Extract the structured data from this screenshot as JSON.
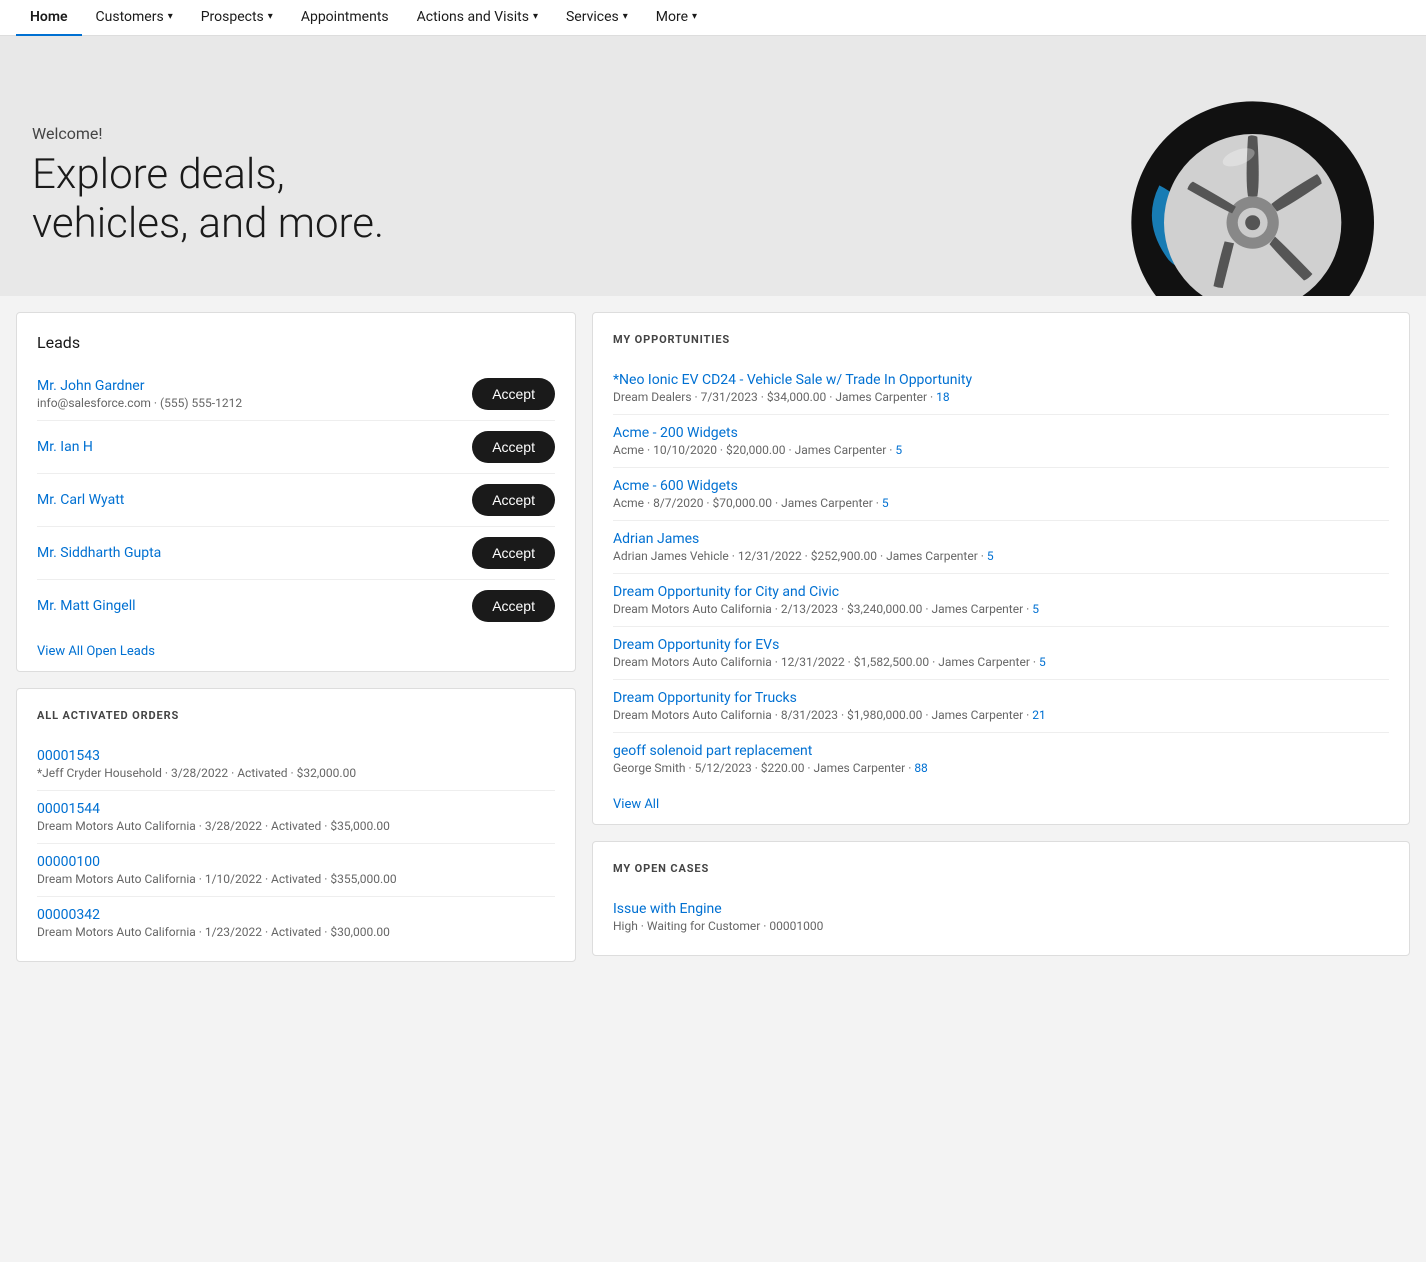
{
  "nav": {
    "items": [
      {
        "id": "home",
        "label": "Home",
        "active": true,
        "has_chevron": false
      },
      {
        "id": "customers",
        "label": "Customers",
        "active": false,
        "has_chevron": true
      },
      {
        "id": "prospects",
        "label": "Prospects",
        "active": false,
        "has_chevron": true
      },
      {
        "id": "appointments",
        "label": "Appointments",
        "active": false,
        "has_chevron": false
      },
      {
        "id": "actions-visits",
        "label": "Actions and Visits",
        "active": false,
        "has_chevron": true
      },
      {
        "id": "services",
        "label": "Services",
        "active": false,
        "has_chevron": true
      },
      {
        "id": "more",
        "label": "More",
        "active": false,
        "has_chevron": true
      }
    ]
  },
  "hero": {
    "welcome": "Welcome!",
    "headline": "Explore deals,\nvehicles, and more."
  },
  "leads": {
    "section_title": "Leads",
    "items": [
      {
        "name": "Mr. John Gardner",
        "contact": "info@salesforce.com · (555) 555-1212",
        "button": "Accept"
      },
      {
        "name": "Mr. Ian H",
        "contact": "",
        "button": "Accept"
      },
      {
        "name": "Mr. Carl Wyatt",
        "contact": "",
        "button": "Accept"
      },
      {
        "name": "Mr. Siddharth Gupta",
        "contact": "",
        "button": "Accept"
      },
      {
        "name": "Mr. Matt Gingell",
        "contact": "",
        "button": "Accept"
      }
    ],
    "view_all": "View All Open Leads"
  },
  "orders": {
    "section_title": "ALL ACTIVATED ORDERS",
    "items": [
      {
        "id": "00001543",
        "meta": "*Jeff Cryder Household · 3/28/2022 · Activated · $32,000.00"
      },
      {
        "id": "00001544",
        "meta": "Dream Motors Auto California · 3/28/2022 · Activated · $35,000.00"
      },
      {
        "id": "00000100",
        "meta": "Dream Motors Auto California · 1/10/2022 · Activated · $355,000.00"
      },
      {
        "id": "00000342",
        "meta": "Dream Motors Auto California · 1/23/2022 · Activated · $30,000.00"
      }
    ]
  },
  "opportunities": {
    "section_title": "MY OPPORTUNITIES",
    "items": [
      {
        "title": "*Neo Ionic EV CD24 - Vehicle Sale w/ Trade In Opportunity",
        "meta": "Dream Dealers · 7/31/2023 · $34,000.00 · James Carpenter ·",
        "count": "18"
      },
      {
        "title": "Acme - 200 Widgets",
        "meta": "Acme · 10/10/2020 · $20,000.00 · James Carpenter ·",
        "count": "5"
      },
      {
        "title": "Acme - 600 Widgets",
        "meta": "Acme · 8/7/2020 · $70,000.00 · James Carpenter ·",
        "count": "5"
      },
      {
        "title": "Adrian James",
        "meta": "Adrian James Vehicle · 12/31/2022 · $252,900.00 · James Carpenter ·",
        "count": "5"
      },
      {
        "title": "Dream Opportunity for City and Civic",
        "meta": "Dream Motors Auto California · 2/13/2023 · $3,240,000.00 · James Carpenter ·",
        "count": "5"
      },
      {
        "title": "Dream Opportunity for EVs",
        "meta": "Dream Motors Auto California · 12/31/2022 · $1,582,500.00 · James Carpenter ·",
        "count": "5"
      },
      {
        "title": "Dream Opportunity for Trucks",
        "meta": "Dream Motors Auto California · 8/31/2023 · $1,980,000.00 · James Carpenter ·",
        "count": "21"
      },
      {
        "title": "geoff solenoid part replacement",
        "meta": "George Smith · 5/12/2023 · $220.00 · James Carpenter ·",
        "count": "88"
      }
    ],
    "view_all": "View All"
  },
  "cases": {
    "section_title": "MY OPEN CASES",
    "items": [
      {
        "title": "Issue with Engine",
        "meta": "High · Waiting for Customer · 00001000"
      }
    ]
  },
  "colors": {
    "link": "#0070d2",
    "nav_active_border": "#0070d2",
    "accept_btn_bg": "#1a1a1a"
  }
}
